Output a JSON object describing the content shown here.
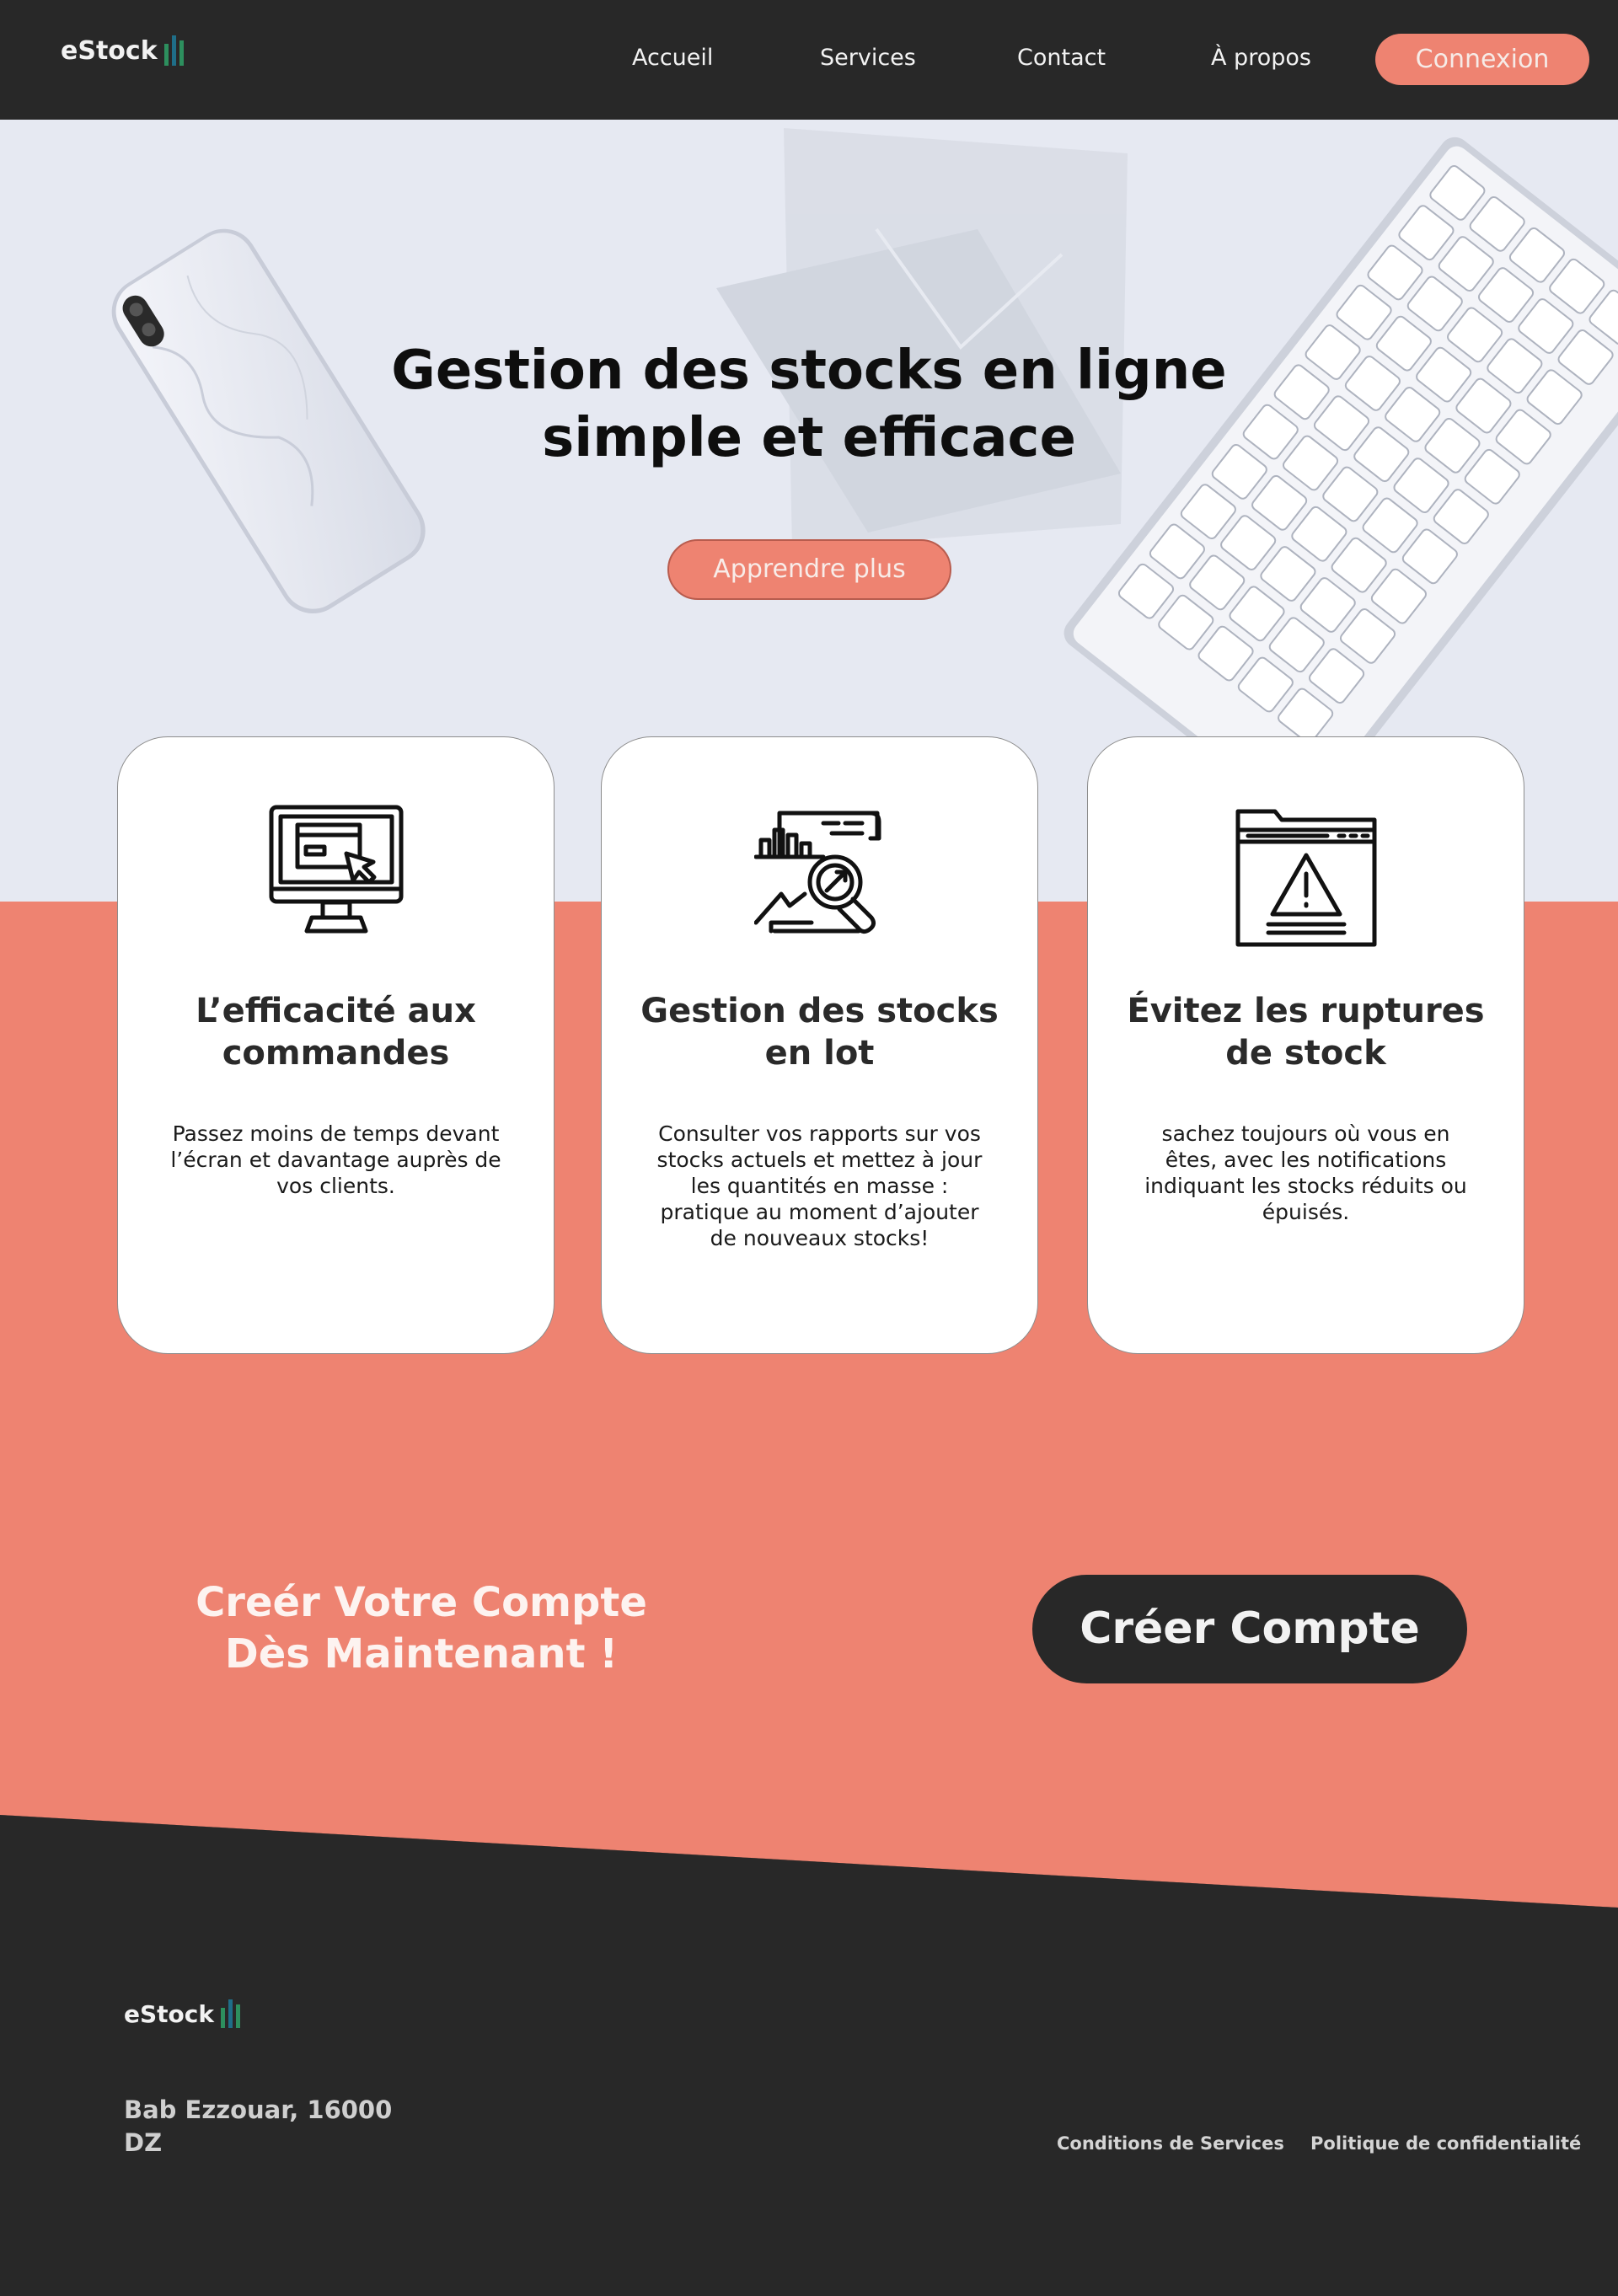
{
  "brand": {
    "name": "eStock",
    "bar_colors": [
      "#2d8f5e",
      "#1f6e88",
      "#2d8f5e"
    ]
  },
  "nav": {
    "items": [
      "Accueil",
      "Services",
      "Contact",
      "À propos"
    ],
    "login_label": "Connexion"
  },
  "hero": {
    "title_line1": "Gestion des stocks en ligne",
    "title_line2": "simple et efficace",
    "button_label": "Apprendre plus"
  },
  "features": [
    {
      "icon": "computer-monitor-icon",
      "title": "L’efficacité aux commandes",
      "description": "Passez moins de temps devant l’écran et davantage auprès de vos clients."
    },
    {
      "icon": "report-analytics-icon",
      "title": "Gestion des stocks en lot",
      "description": "Consulter vos rapports sur vos stocks actuels et mettez à jour les quantités en masse : pratique au moment d’ajouter de nouveaux stocks!"
    },
    {
      "icon": "warning-window-icon",
      "title": "Évitez les ruptures de stock",
      "description": "sachez toujours où vous en êtes, avec les notifications indiquant les stocks réduits ou épuisés."
    }
  ],
  "cta": {
    "line1": "Creér Votre Compte",
    "line2": "Dès Maintenant !",
    "button_label": "Créer Compte"
  },
  "footer": {
    "address_line1": "Bab Ezzouar, 16000",
    "address_line2": "DZ",
    "links": [
      "Conditions de Services",
      "Politique de confidentialité"
    ]
  },
  "colors": {
    "dark": "#282828",
    "accent": "#ee8371",
    "hero_bg": "#e6e9f2"
  }
}
